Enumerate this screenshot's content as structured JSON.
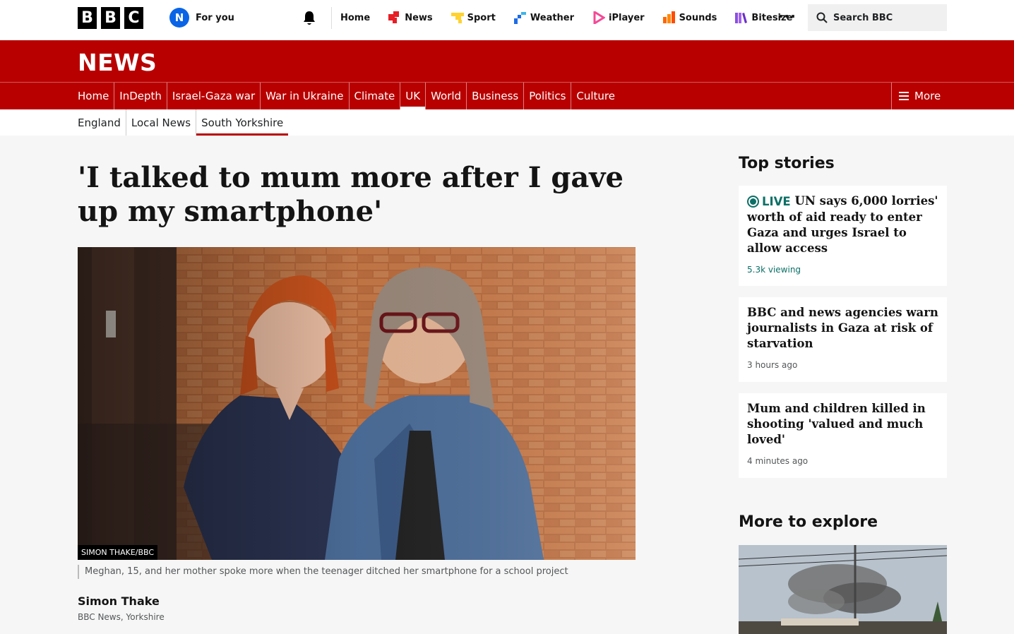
{
  "masthead": {
    "logo_letters": [
      "B",
      "B",
      "C"
    ],
    "avatar_initial": "N",
    "for_you_label": "For you",
    "nav": [
      {
        "label": "Home",
        "icon": "none"
      },
      {
        "label": "News",
        "icon": "news-icon",
        "color": "#e61e26"
      },
      {
        "label": "Sport",
        "icon": "sport-icon",
        "color": "#ffd230"
      },
      {
        "label": "Weather",
        "icon": "weather-icon",
        "color": "#1e6be6"
      },
      {
        "label": "iPlayer",
        "icon": "iplayer-icon",
        "color": "#f54996"
      },
      {
        "label": "Sounds",
        "icon": "sounds-icon",
        "color": "#ff6600"
      },
      {
        "label": "Bitesize",
        "icon": "bitesize-icon",
        "color": "#8a4fe0"
      }
    ],
    "more_label": "···",
    "search_placeholder": "Search BBC"
  },
  "news_logo": "NEWS",
  "section_nav": {
    "items": [
      "Home",
      "InDepth",
      "Israel-Gaza war",
      "War in Ukraine",
      "Climate",
      "UK",
      "World",
      "Business",
      "Politics",
      "Culture"
    ],
    "active": "UK",
    "more_label": "More"
  },
  "sub_nav": {
    "items": [
      "England",
      "Local News",
      "South Yorkshire"
    ],
    "active": "South Yorkshire"
  },
  "article": {
    "headline": "'I talked to mum more after I gave up my smartphone'",
    "image_credit": "SIMON THAKE/BBC",
    "caption": "Meghan, 15, and her mother spoke more when the teenager ditched her smartphone for a school project",
    "author_name": "Simon Thake",
    "author_role": "BBC News, Yorkshire"
  },
  "sidebar": {
    "top_stories_heading": "Top stories",
    "stories": [
      {
        "live_label": "LIVE",
        "title": "UN says 6,000 lorries' worth of aid ready to enter Gaza and urges Israel to allow access",
        "meta": "5.3k viewing"
      },
      {
        "title": "BBC and news agencies warn journalists in Gaza at risk of starvation",
        "meta": "3 hours ago"
      },
      {
        "title": "Mum and children killed in shooting 'valued and much loved'",
        "meta": "4 minutes ago"
      }
    ],
    "more_to_explore_heading": "More to explore"
  },
  "colors": {
    "brand_red": "#b80000",
    "live_teal": "#0c7066"
  }
}
